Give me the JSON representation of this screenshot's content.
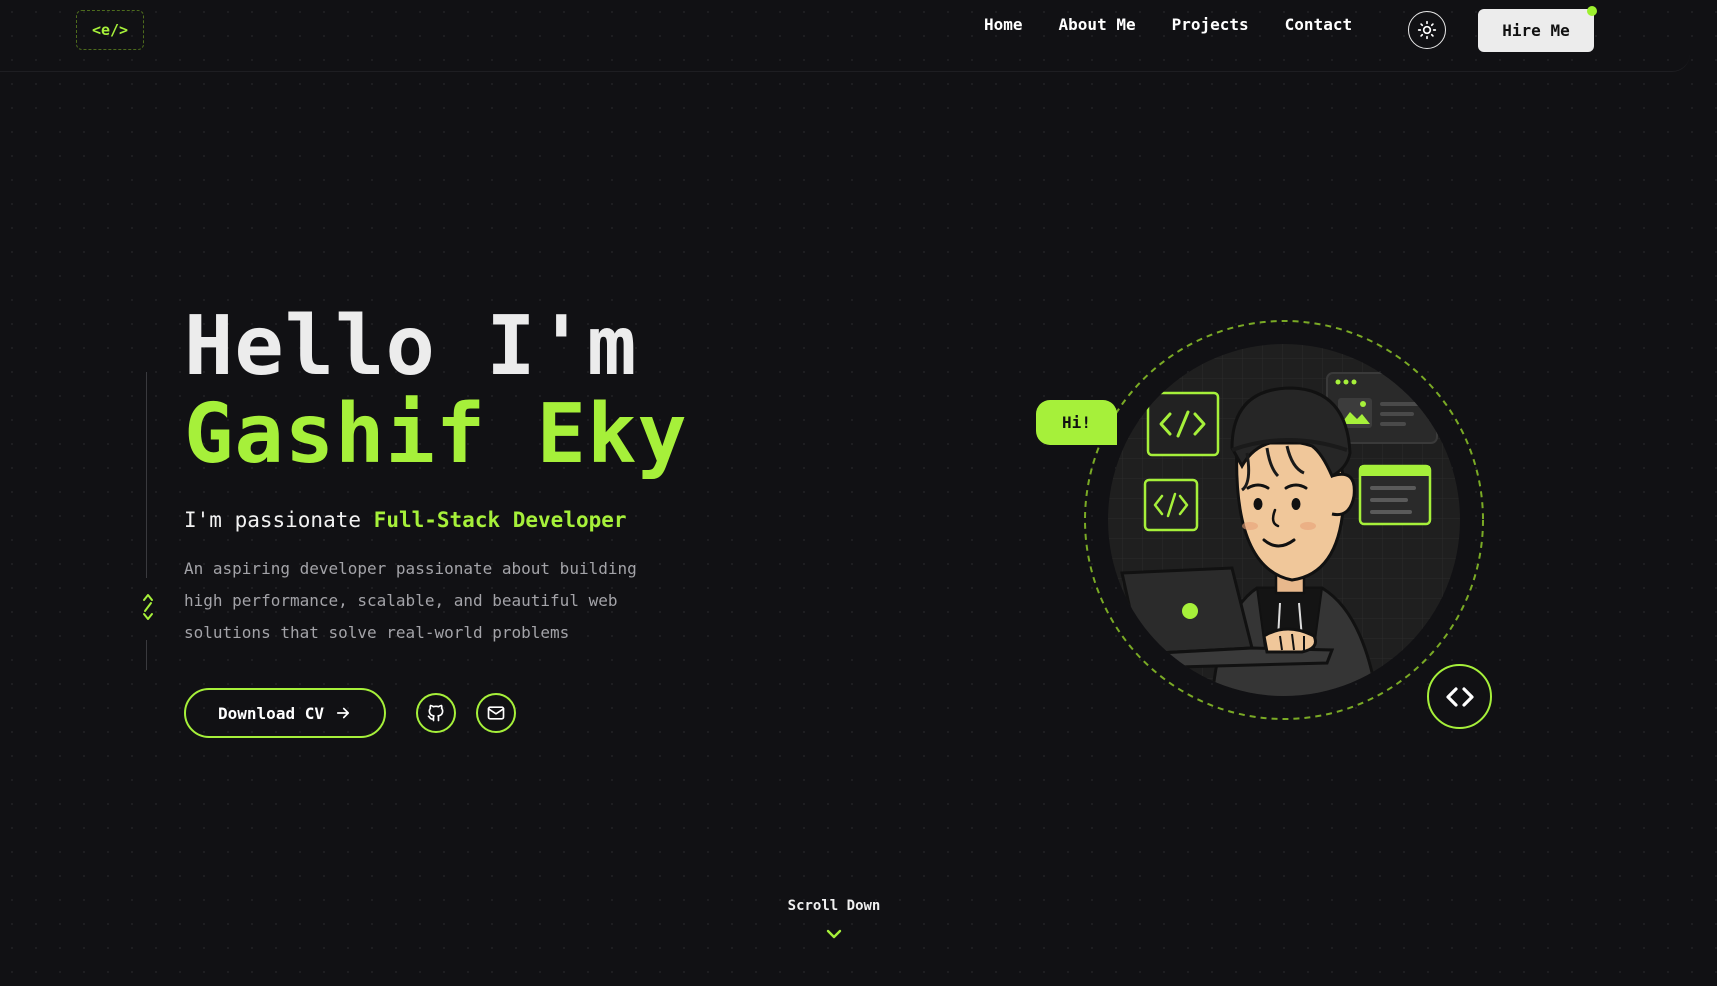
{
  "header": {
    "logo": "<e/>",
    "nav": [
      "Home",
      "About Me",
      "Projects",
      "Contact"
    ],
    "hire_label": "Hire Me"
  },
  "hero": {
    "greeting": "Hello I'm",
    "name": "Gashif Eky",
    "tagline_prefix": "I'm passionate",
    "tagline_role": "Full-Stack Developer",
    "description": "An aspiring developer passionate about building high performance, scalable, and beautiful web solutions that solve real-world problems",
    "cv_label": "Download CV",
    "side_icon": "</>"
  },
  "illustration": {
    "bubble": "Hi!"
  },
  "scroll": {
    "label": "Scroll Down"
  },
  "theme": {
    "accent": "#a6f03a",
    "background": "#111114",
    "text": "#f2f2f2",
    "muted": "#a3a3a8"
  },
  "icons": [
    "sun-icon",
    "github-icon",
    "mail-icon",
    "arrow-right-icon",
    "code-icon",
    "chevron-down-icon"
  ]
}
